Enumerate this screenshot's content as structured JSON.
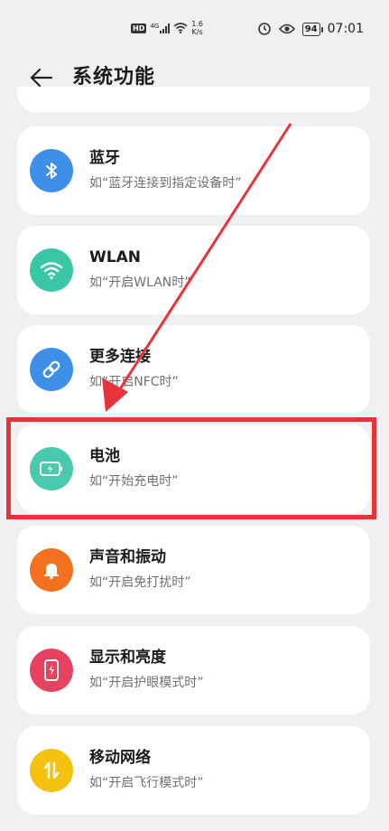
{
  "status_bar": {
    "hd": "HD",
    "network_type": "4G",
    "speed_value": "1.6",
    "speed_unit": "K/s",
    "battery": "94",
    "time": "07:01"
  },
  "header": {
    "title": "系统功能"
  },
  "items": [
    {
      "title": "蓝牙",
      "subtitle": "如“蓝牙连接到指定设备时”",
      "color": "#3d8fe8",
      "icon": "bluetooth-icon"
    },
    {
      "title": "WLAN",
      "subtitle": "如“开启WLAN时”",
      "color": "#39c7a6",
      "icon": "wifi-icon"
    },
    {
      "title": "更多连接",
      "subtitle": "如“开启NFC时”",
      "color": "#3d8fe8",
      "icon": "link-icon"
    },
    {
      "title": "电池",
      "subtitle": "如“开始充电时”",
      "color": "#49c9ae",
      "icon": "battery-charging-icon"
    },
    {
      "title": "声音和振动",
      "subtitle": "如“开启免打扰时”",
      "color": "#f2701e",
      "icon": "bell-icon"
    },
    {
      "title": "显示和亮度",
      "subtitle": "如“开启护眼模式时”",
      "color": "#e84261",
      "icon": "phone-display-icon"
    },
    {
      "title": "移动网络",
      "subtitle": "如“开启飞行模式时”",
      "color": "#f5c20f",
      "icon": "mobile-data-icon"
    }
  ],
  "annotation": {
    "highlight_color": "#e8333a"
  }
}
